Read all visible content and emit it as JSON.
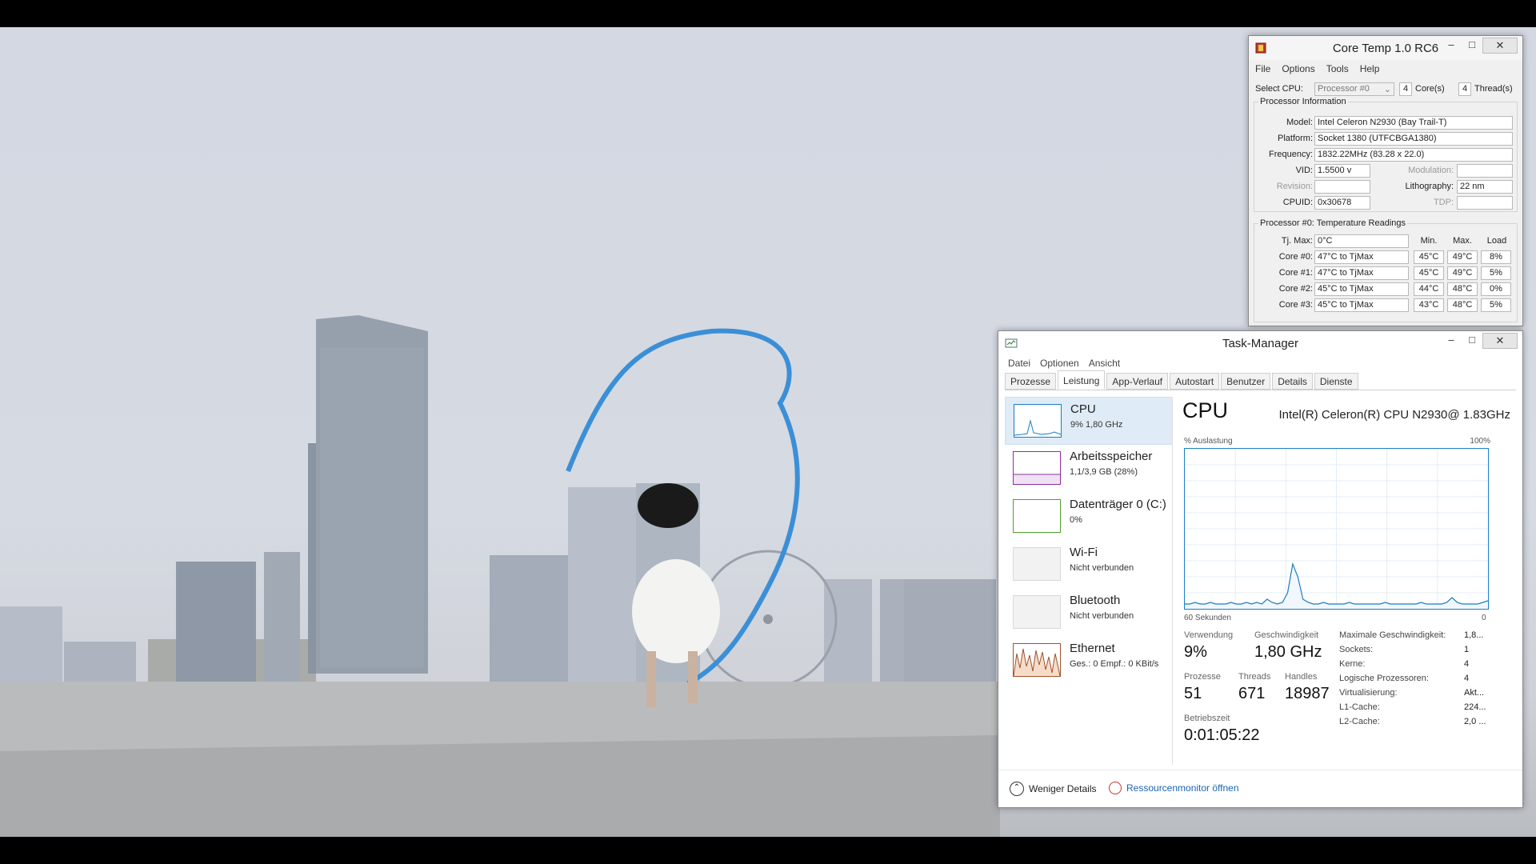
{
  "coretemp": {
    "title": "Core Temp 1.0 RC6",
    "menu": [
      "File",
      "Options",
      "Tools",
      "Help"
    ],
    "select_cpu_label": "Select CPU:",
    "select_cpu_value": "Processor #0",
    "cores_count": "4",
    "cores_label": "Core(s)",
    "threads_count": "4",
    "threads_label": "Thread(s)",
    "info_group": "Processor Information",
    "model_label": "Model:",
    "model": "Intel Celeron N2930 (Bay Trail-T)",
    "platform_label": "Platform:",
    "platform": "Socket 1380 (UTFCBGA1380)",
    "frequency_label": "Frequency:",
    "frequency": "1832.22MHz (83.28 x 22.0)",
    "vid_label": "VID:",
    "vid": "1.5500 v",
    "modulation_label": "Modulation:",
    "revision_label": "Revision:",
    "lithography_label": "Lithography:",
    "lithography": "22 nm",
    "cpuid_label": "CPUID:",
    "cpuid": "0x30678",
    "tdp_label": "TDP:",
    "temps_group": "Processor #0: Temperature Readings",
    "tjmax_label": "Tj. Max:",
    "tjmax": "0°C",
    "col_min": "Min.",
    "col_max": "Max.",
    "col_load": "Load",
    "cores": [
      {
        "label": "Core #0:",
        "temp": "47°C to TjMax",
        "min": "45°C",
        "max": "49°C",
        "load": "8%"
      },
      {
        "label": "Core #1:",
        "temp": "47°C to TjMax",
        "min": "45°C",
        "max": "49°C",
        "load": "5%"
      },
      {
        "label": "Core #2:",
        "temp": "45°C to TjMax",
        "min": "44°C",
        "max": "48°C",
        "load": "0%"
      },
      {
        "label": "Core #3:",
        "temp": "45°C to TjMax",
        "min": "43°C",
        "max": "48°C",
        "load": "5%"
      }
    ]
  },
  "taskmgr": {
    "title": "Task-Manager",
    "menu": [
      "Datei",
      "Optionen",
      "Ansicht"
    ],
    "tabs": [
      "Prozesse",
      "Leistung",
      "App-Verlauf",
      "Autostart",
      "Benutzer",
      "Details",
      "Dienste"
    ],
    "active_tab": "Leistung",
    "side": [
      {
        "title": "CPU",
        "sub": "9%  1,80 GHz"
      },
      {
        "title": "Arbeitsspeicher",
        "sub": "1,1/3,9 GB (28%)"
      },
      {
        "title": "Datenträger 0 (C:)",
        "sub": "0%"
      },
      {
        "title": "Wi-Fi",
        "sub": "Nicht verbunden"
      },
      {
        "title": "Bluetooth",
        "sub": "Nicht verbunden"
      },
      {
        "title": "Ethernet",
        "sub": "Ges.: 0  Empf.: 0 KBit/s"
      }
    ],
    "cpu_heading": "CPU",
    "cpu_model": "Intel(R) Celeron(R) CPU N2930@ 1.83GHz",
    "util_label": "% Auslastung",
    "util_max": "100%",
    "time_label": "60 Sekunden",
    "time_end": "0",
    "stats": {
      "usage_label": "Verwendung",
      "usage": "9%",
      "speed_label": "Geschwindigkeit",
      "speed": "1,80 GHz",
      "procs_label": "Prozesse",
      "procs": "51",
      "threads_label": "Threads",
      "threads": "671",
      "handles_label": "Handles",
      "handles": "18987",
      "uptime_label": "Betriebszeit",
      "uptime": "0:01:05:22"
    },
    "details": [
      {
        "label": "Maximale Geschwindigkeit:",
        "value": "1,8..."
      },
      {
        "label": "Sockets:",
        "value": "1"
      },
      {
        "label": "Kerne:",
        "value": "4"
      },
      {
        "label": "Logische Prozessoren:",
        "value": "4"
      },
      {
        "label": "Virtualisierung:",
        "value": "Akt..."
      },
      {
        "label": "L1-Cache:",
        "value": "224..."
      },
      {
        "label": "L2-Cache:",
        "value": "2,0 ..."
      }
    ],
    "fewer_details": "Weniger Details",
    "resource_monitor": "Ressourcenmonitor öffnen",
    "cpu_history": [
      3,
      3,
      4,
      3,
      3,
      4,
      3,
      3,
      3,
      4,
      3,
      3,
      4,
      3,
      4,
      3,
      6,
      4,
      3,
      4,
      10,
      28,
      20,
      6,
      4,
      3,
      3,
      4,
      3,
      3,
      3,
      3,
      4,
      3,
      3,
      3,
      3,
      3,
      3,
      4,
      3,
      3,
      3,
      3,
      3,
      3,
      4,
      3,
      3,
      3,
      3,
      4,
      7,
      4,
      3,
      3,
      3,
      3,
      4,
      5
    ]
  }
}
